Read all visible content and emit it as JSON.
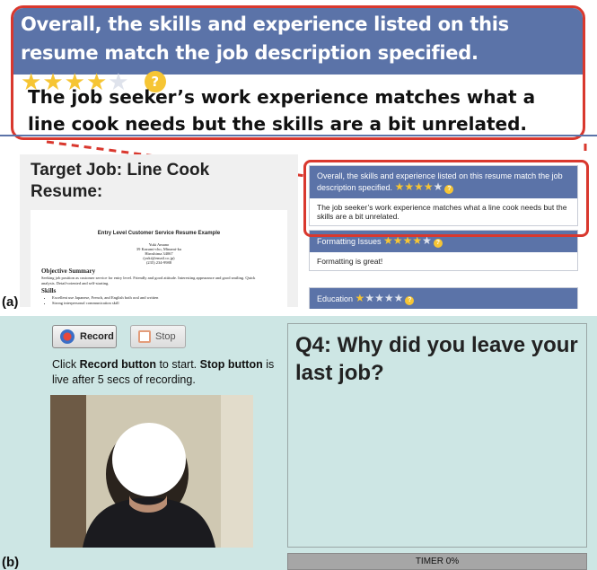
{
  "panel_a": {
    "label": "(a)",
    "zoom": {
      "title": "Overall, the skills and experience listed on this resume match the job description specified.",
      "rating": 4,
      "max_rating": 5,
      "help_glyph": "?",
      "body": "The job seeker’s work experience matches what a line cook needs but the skills are a bit unrelated."
    },
    "resume": {
      "target_job": "Target Job: Line Cook Resume:",
      "doc_title": "Entry Level Customer Service Resume Example",
      "contact_lines": [
        "Yuki Amano",
        "39 Kazumi-cho, Minami-ku",
        "Hiroshima 34067",
        "(yuki@email.co.jp)",
        "(235) 234-9988"
      ],
      "objective_heading": "Objective Summary",
      "objective_text": "Seeking job position as customer service for entry level. Friendly and good attitude. Interesting appearance and good smiling. Quick analysis. Detail-oriented and self-starting.",
      "skills_heading": "Skills",
      "skills": [
        "Excellent use Japanese, French, and English both oral and written",
        "Strong interpersonal communication skill"
      ]
    },
    "feedback": [
      {
        "title": "Overall, the skills and experience listed on this resume match the job description specified.",
        "rating": 4,
        "text": "The job seeker’s work experience matches what a line cook needs but the skills are a bit unrelated."
      },
      {
        "title": "Formatting Issues",
        "rating": 4,
        "text": "Formatting is great!"
      },
      {
        "title": "Education",
        "rating": 1,
        "text": ""
      }
    ],
    "colors": {
      "header_blue": "#5b73a8",
      "highlight_red": "#d9382e",
      "star_gold": "#f6c534"
    }
  },
  "panel_b": {
    "label": "(b)",
    "record_label": "Record",
    "stop_label": "Stop",
    "instructions": {
      "p1": "Click ",
      "record_word": "Record button",
      "p2": " to start. ",
      "stop_word": "Stop button",
      "p3": " is live after 5 secs of recording."
    },
    "question": "Q4: Why did you leave your last job?",
    "timer_label": "TIMER 0%",
    "timer_progress": 0,
    "colors": {
      "background": "#cde6e4",
      "timer_gray": "#a6a6a6"
    }
  }
}
